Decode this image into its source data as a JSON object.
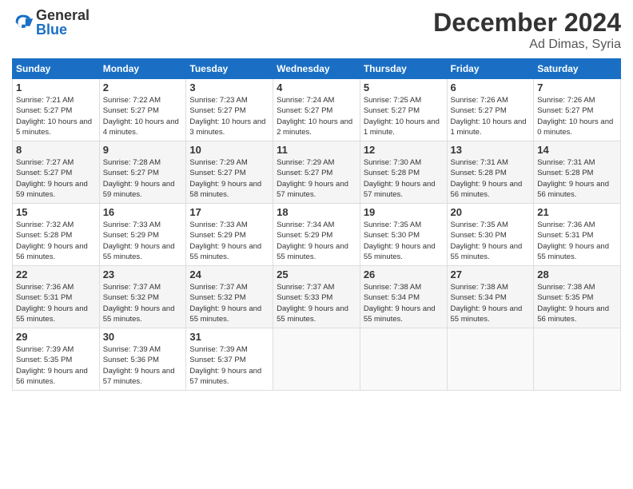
{
  "logo": {
    "general": "General",
    "blue": "Blue"
  },
  "title": "December 2024",
  "location": "Ad Dimas, Syria",
  "days_of_week": [
    "Sunday",
    "Monday",
    "Tuesday",
    "Wednesday",
    "Thursday",
    "Friday",
    "Saturday"
  ],
  "weeks": [
    [
      {
        "day": 1,
        "sunrise": "7:21 AM",
        "sunset": "5:27 PM",
        "daylight": "10 hours and 5 minutes."
      },
      {
        "day": 2,
        "sunrise": "7:22 AM",
        "sunset": "5:27 PM",
        "daylight": "10 hours and 4 minutes."
      },
      {
        "day": 3,
        "sunrise": "7:23 AM",
        "sunset": "5:27 PM",
        "daylight": "10 hours and 3 minutes."
      },
      {
        "day": 4,
        "sunrise": "7:24 AM",
        "sunset": "5:27 PM",
        "daylight": "10 hours and 2 minutes."
      },
      {
        "day": 5,
        "sunrise": "7:25 AM",
        "sunset": "5:27 PM",
        "daylight": "10 hours and 1 minute."
      },
      {
        "day": 6,
        "sunrise": "7:26 AM",
        "sunset": "5:27 PM",
        "daylight": "10 hours and 1 minute."
      },
      {
        "day": 7,
        "sunrise": "7:26 AM",
        "sunset": "5:27 PM",
        "daylight": "10 hours and 0 minutes."
      }
    ],
    [
      {
        "day": 8,
        "sunrise": "7:27 AM",
        "sunset": "5:27 PM",
        "daylight": "9 hours and 59 minutes."
      },
      {
        "day": 9,
        "sunrise": "7:28 AM",
        "sunset": "5:27 PM",
        "daylight": "9 hours and 59 minutes."
      },
      {
        "day": 10,
        "sunrise": "7:29 AM",
        "sunset": "5:27 PM",
        "daylight": "9 hours and 58 minutes."
      },
      {
        "day": 11,
        "sunrise": "7:29 AM",
        "sunset": "5:27 PM",
        "daylight": "9 hours and 57 minutes."
      },
      {
        "day": 12,
        "sunrise": "7:30 AM",
        "sunset": "5:28 PM",
        "daylight": "9 hours and 57 minutes."
      },
      {
        "day": 13,
        "sunrise": "7:31 AM",
        "sunset": "5:28 PM",
        "daylight": "9 hours and 56 minutes."
      },
      {
        "day": 14,
        "sunrise": "7:31 AM",
        "sunset": "5:28 PM",
        "daylight": "9 hours and 56 minutes."
      }
    ],
    [
      {
        "day": 15,
        "sunrise": "7:32 AM",
        "sunset": "5:28 PM",
        "daylight": "9 hours and 56 minutes."
      },
      {
        "day": 16,
        "sunrise": "7:33 AM",
        "sunset": "5:29 PM",
        "daylight": "9 hours and 55 minutes."
      },
      {
        "day": 17,
        "sunrise": "7:33 AM",
        "sunset": "5:29 PM",
        "daylight": "9 hours and 55 minutes."
      },
      {
        "day": 18,
        "sunrise": "7:34 AM",
        "sunset": "5:29 PM",
        "daylight": "9 hours and 55 minutes."
      },
      {
        "day": 19,
        "sunrise": "7:35 AM",
        "sunset": "5:30 PM",
        "daylight": "9 hours and 55 minutes."
      },
      {
        "day": 20,
        "sunrise": "7:35 AM",
        "sunset": "5:30 PM",
        "daylight": "9 hours and 55 minutes."
      },
      {
        "day": 21,
        "sunrise": "7:36 AM",
        "sunset": "5:31 PM",
        "daylight": "9 hours and 55 minutes."
      }
    ],
    [
      {
        "day": 22,
        "sunrise": "7:36 AM",
        "sunset": "5:31 PM",
        "daylight": "9 hours and 55 minutes."
      },
      {
        "day": 23,
        "sunrise": "7:37 AM",
        "sunset": "5:32 PM",
        "daylight": "9 hours and 55 minutes."
      },
      {
        "day": 24,
        "sunrise": "7:37 AM",
        "sunset": "5:32 PM",
        "daylight": "9 hours and 55 minutes."
      },
      {
        "day": 25,
        "sunrise": "7:37 AM",
        "sunset": "5:33 PM",
        "daylight": "9 hours and 55 minutes."
      },
      {
        "day": 26,
        "sunrise": "7:38 AM",
        "sunset": "5:34 PM",
        "daylight": "9 hours and 55 minutes."
      },
      {
        "day": 27,
        "sunrise": "7:38 AM",
        "sunset": "5:34 PM",
        "daylight": "9 hours and 55 minutes."
      },
      {
        "day": 28,
        "sunrise": "7:38 AM",
        "sunset": "5:35 PM",
        "daylight": "9 hours and 56 minutes."
      }
    ],
    [
      {
        "day": 29,
        "sunrise": "7:39 AM",
        "sunset": "5:35 PM",
        "daylight": "9 hours and 56 minutes."
      },
      {
        "day": 30,
        "sunrise": "7:39 AM",
        "sunset": "5:36 PM",
        "daylight": "9 hours and 57 minutes."
      },
      {
        "day": 31,
        "sunrise": "7:39 AM",
        "sunset": "5:37 PM",
        "daylight": "9 hours and 57 minutes."
      },
      null,
      null,
      null,
      null
    ]
  ]
}
